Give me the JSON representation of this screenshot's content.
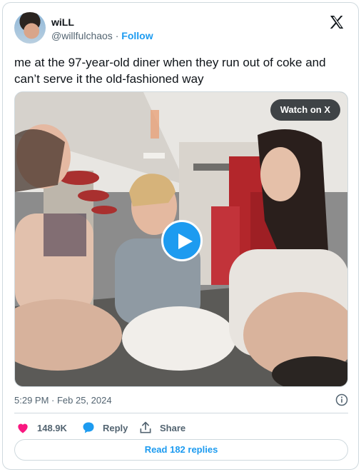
{
  "author": {
    "name": "wiLL",
    "handle": "@willfulchaos",
    "separator": "·",
    "follow_label": "Follow"
  },
  "tweet": {
    "text": "me at the 97-year-old diner when they run out of coke and can’t serve it the old-fashioned way"
  },
  "media": {
    "watch_label": "Watch on X",
    "play_icon": "play-icon"
  },
  "meta": {
    "timestamp": "5:29 PM · Feb 25, 2024",
    "info_icon": "info-icon"
  },
  "actions": {
    "likes": "148.9K",
    "reply_label": "Reply",
    "share_label": "Share"
  },
  "replies": {
    "label": "Read 182 replies"
  },
  "colors": {
    "accent": "#1d9bf0",
    "like": "#f91880",
    "text": "#0f1419",
    "secondary": "#536471",
    "border": "#cfd9de"
  }
}
